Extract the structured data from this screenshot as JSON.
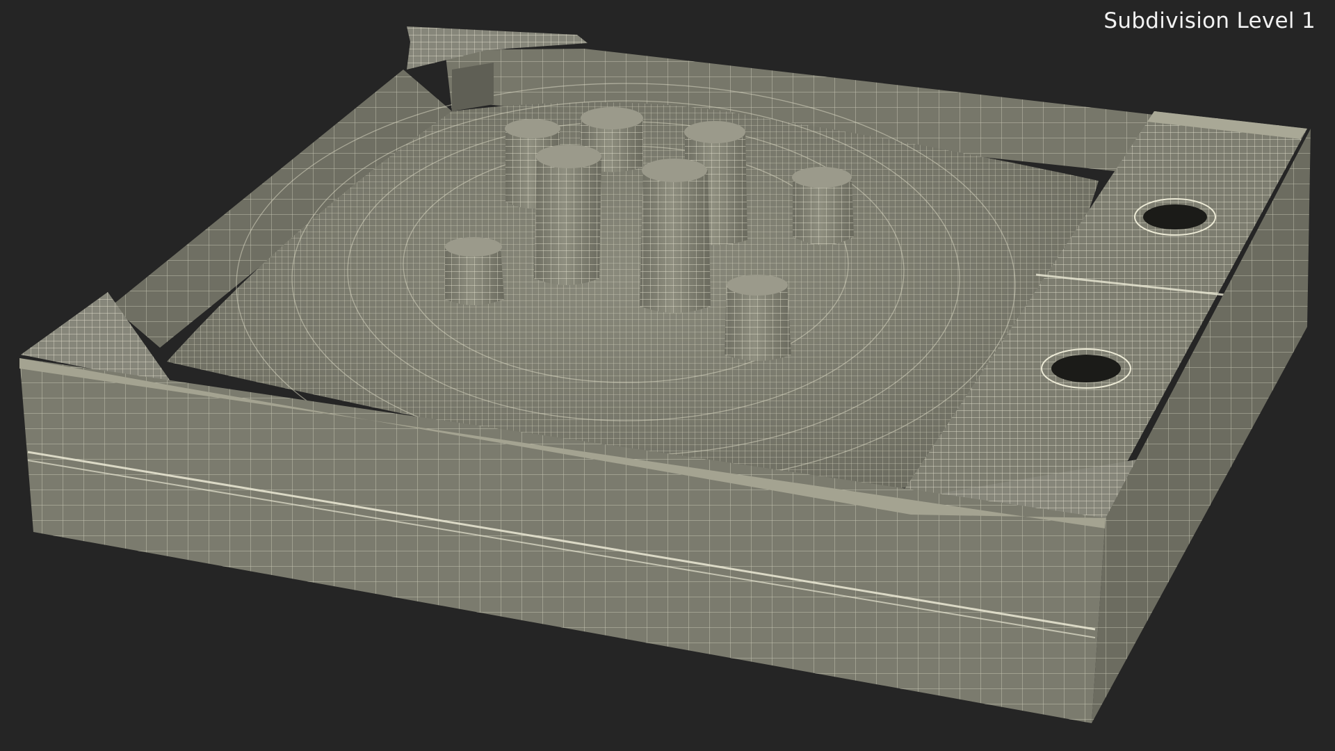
{
  "viewport": {
    "subdivision_label": "Subdivision Level 1",
    "background_color": "#252525"
  },
  "model": {
    "subject": "sandbox-with-sand-castle-wireframe",
    "surface_color": "#7b7b6e",
    "wire_color": "#e9e7d3"
  }
}
